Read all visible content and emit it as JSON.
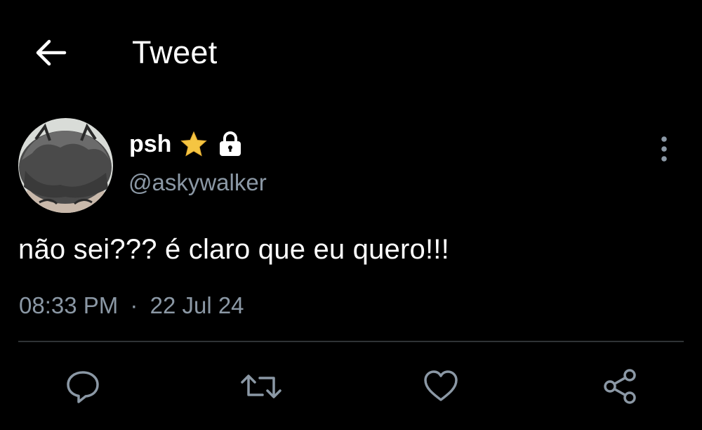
{
  "header": {
    "title": "Tweet",
    "back_icon": "arrow-left-icon"
  },
  "tweet": {
    "author": {
      "display_name": "psh",
      "username": "@askywalker",
      "badges": [
        "star-icon",
        "lock-icon"
      ]
    },
    "text": "não sei??? é claro que eu quero!!!",
    "time": "08:33 PM",
    "separator": "·",
    "date": "22 Jul 24"
  },
  "actions": [
    {
      "name": "reply",
      "icon": "reply-icon"
    },
    {
      "name": "retweet",
      "icon": "retweet-icon"
    },
    {
      "name": "like",
      "icon": "heart-icon"
    },
    {
      "name": "share",
      "icon": "share-icon"
    }
  ],
  "colors": {
    "background": "#000000",
    "text_primary": "#ffffff",
    "text_secondary": "#8b98a5",
    "divider": "#2f3336",
    "star": "#f5c542"
  }
}
